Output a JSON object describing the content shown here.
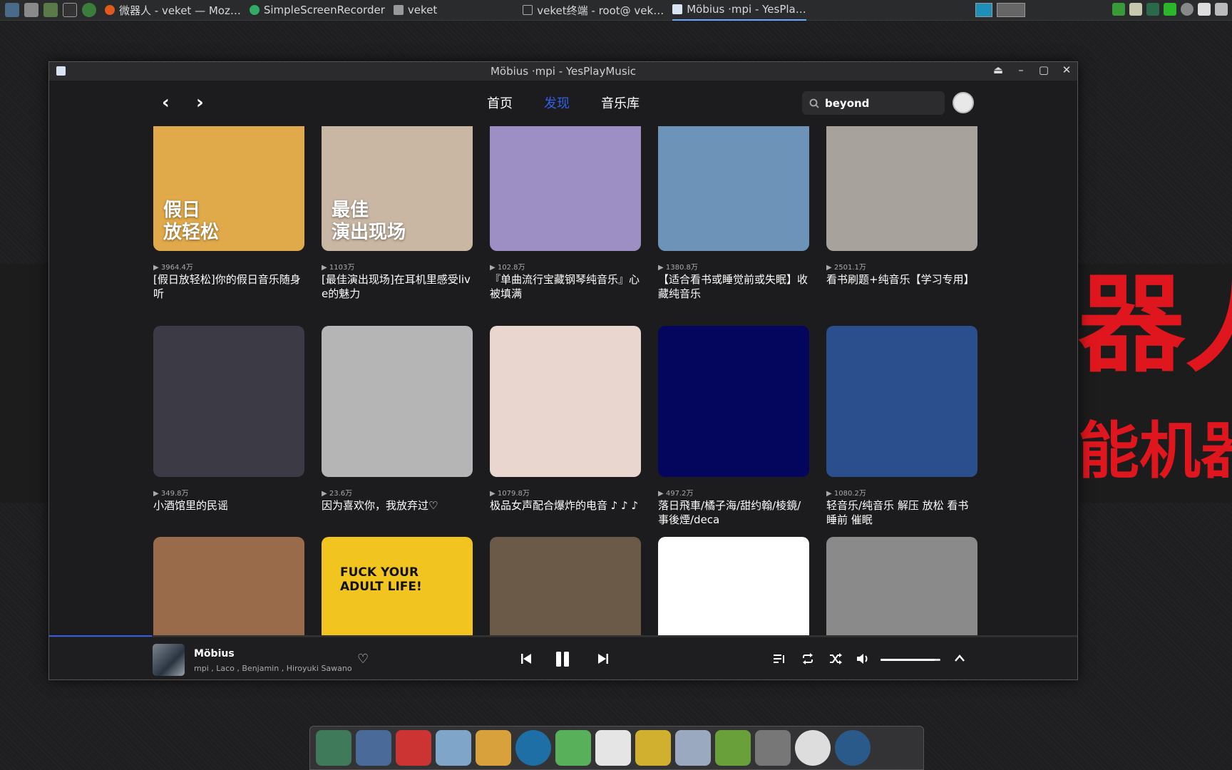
{
  "taskbar": {
    "tasks": [
      {
        "label": "微器人 - veket — Moz…",
        "active": false
      },
      {
        "label": "SimpleScreenRecorder",
        "active": false
      },
      {
        "label": "veket",
        "active": false
      },
      {
        "label": "veket终端 - root@ vek…",
        "active": false
      },
      {
        "label": "Möbius ·mpi - YesPla…",
        "active": true
      }
    ]
  },
  "desktop": {
    "red_text_1": "器人",
    "red_text_2": "能机器"
  },
  "window": {
    "title": "Möbius ·mpi - YesPlayMusic",
    "controls": [
      "⏏",
      "–",
      "▢",
      "✕"
    ]
  },
  "nav": {
    "back": "‹",
    "forward": "›",
    "tabs": [
      {
        "label": "首页",
        "active": false
      },
      {
        "label": "发现",
        "active": true
      },
      {
        "label": "音乐库",
        "active": false
      }
    ],
    "search_value": "beyond"
  },
  "playlists": [
    {
      "plays": "▶ 3964.4万",
      "title": "[假日放轻松]你的假日音乐随身听",
      "caption": "假日\n放轻松",
      "bg": "#e0a94a"
    },
    {
      "plays": "▶ 1103万",
      "title": "[最佳演出现场]在耳机里感受live的魅力",
      "caption": "最佳\n演出现场",
      "bg": "#c9b7a4"
    },
    {
      "plays": "▶ 102.8万",
      "title": "『单曲流行宝藏钢琴纯音乐』心被填满",
      "caption": "",
      "bg": "#9d8fc4"
    },
    {
      "plays": "▶ 1380.8万",
      "title": "【适合看书或睡觉前或失眠】收藏纯音乐",
      "caption": "",
      "bg": "#6e93b8"
    },
    {
      "plays": "▶ 2501.1万",
      "title": "看书刷题+纯音乐【学习专用】",
      "caption": "",
      "bg": "#a7a39c"
    },
    {
      "plays": "▶ 349.8万",
      "title": "小酒馆里的民谣",
      "caption": "",
      "bg": "#3b3a45"
    },
    {
      "plays": "▶ 23.6万",
      "title": "因为喜欢你，我放弃过♡",
      "caption": "",
      "bg": "#b5b5b5"
    },
    {
      "plays": "▶ 1079.8万",
      "title": "极品女声配合爆炸的电音 ♪ ♪ ♪",
      "caption": "",
      "bg": "#e8d6cf"
    },
    {
      "plays": "▶ 497.2万",
      "title": "落日飛車/橘子海/甜约翰/棱鏡/事後煙/deca",
      "caption": "",
      "bg": "#04065e"
    },
    {
      "plays": "▶ 1080.2万",
      "title": "轻音乐/纯音乐 解压 放松 看书 睡前 催眠",
      "caption": "",
      "bg": "#2a4f8c"
    },
    {
      "plays": "",
      "title": "",
      "caption": "",
      "bg": "#9a6b4a"
    },
    {
      "plays": "",
      "title": "",
      "caption": "FUCK YOUR\nADULT LIFE!",
      "bg": "#f2c420"
    },
    {
      "plays": "",
      "title": "",
      "caption": "",
      "bg": "#6b5a48"
    },
    {
      "plays": "",
      "title": "",
      "caption": "",
      "bg": "#ffffff"
    },
    {
      "plays": "",
      "title": "",
      "caption": "",
      "bg": "#8a8a8a"
    }
  ],
  "player": {
    "track": "Möbius",
    "artists": "mpi , Laco , Benjamin , Hiroyuki Sawano",
    "progress": 0.1,
    "volume": 0.9
  }
}
